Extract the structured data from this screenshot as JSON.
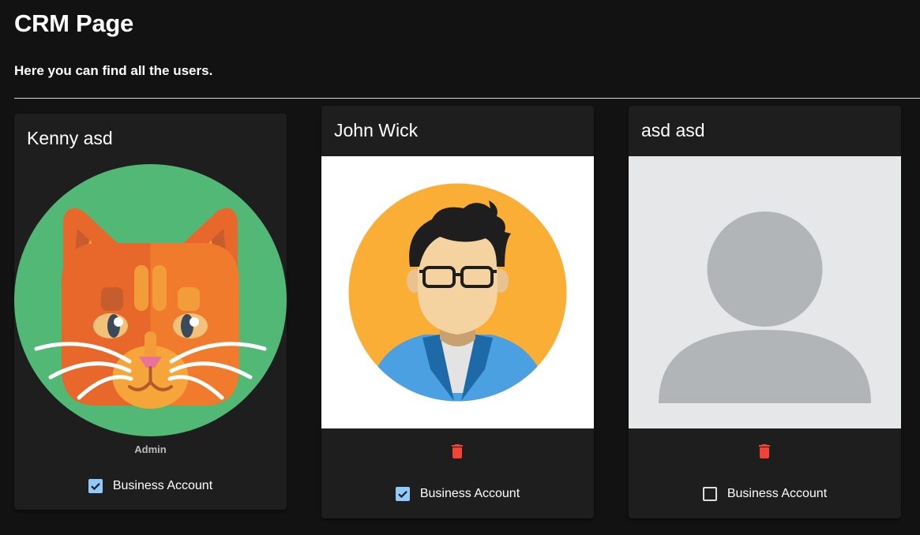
{
  "header": {
    "title": "CRM Page",
    "subtitle": "Here you can find all the users."
  },
  "users": [
    {
      "name": "Kenny asd",
      "avatar": "cat-avatar",
      "role": "Admin",
      "business_label": "Business Account",
      "business_account": true
    },
    {
      "name": "John Wick",
      "avatar": "man-avatar",
      "delete_icon": "trash-icon",
      "business_label": "Business Account",
      "business_account": true
    },
    {
      "name": "asd asd",
      "avatar": "placeholder-avatar",
      "delete_icon": "trash-icon",
      "business_label": "Business Account",
      "business_account": false
    }
  ],
  "colors": {
    "background": "#121212",
    "card": "#1e1e1e",
    "delete": "#f44336",
    "checkbox_checked": "#90caf9"
  }
}
